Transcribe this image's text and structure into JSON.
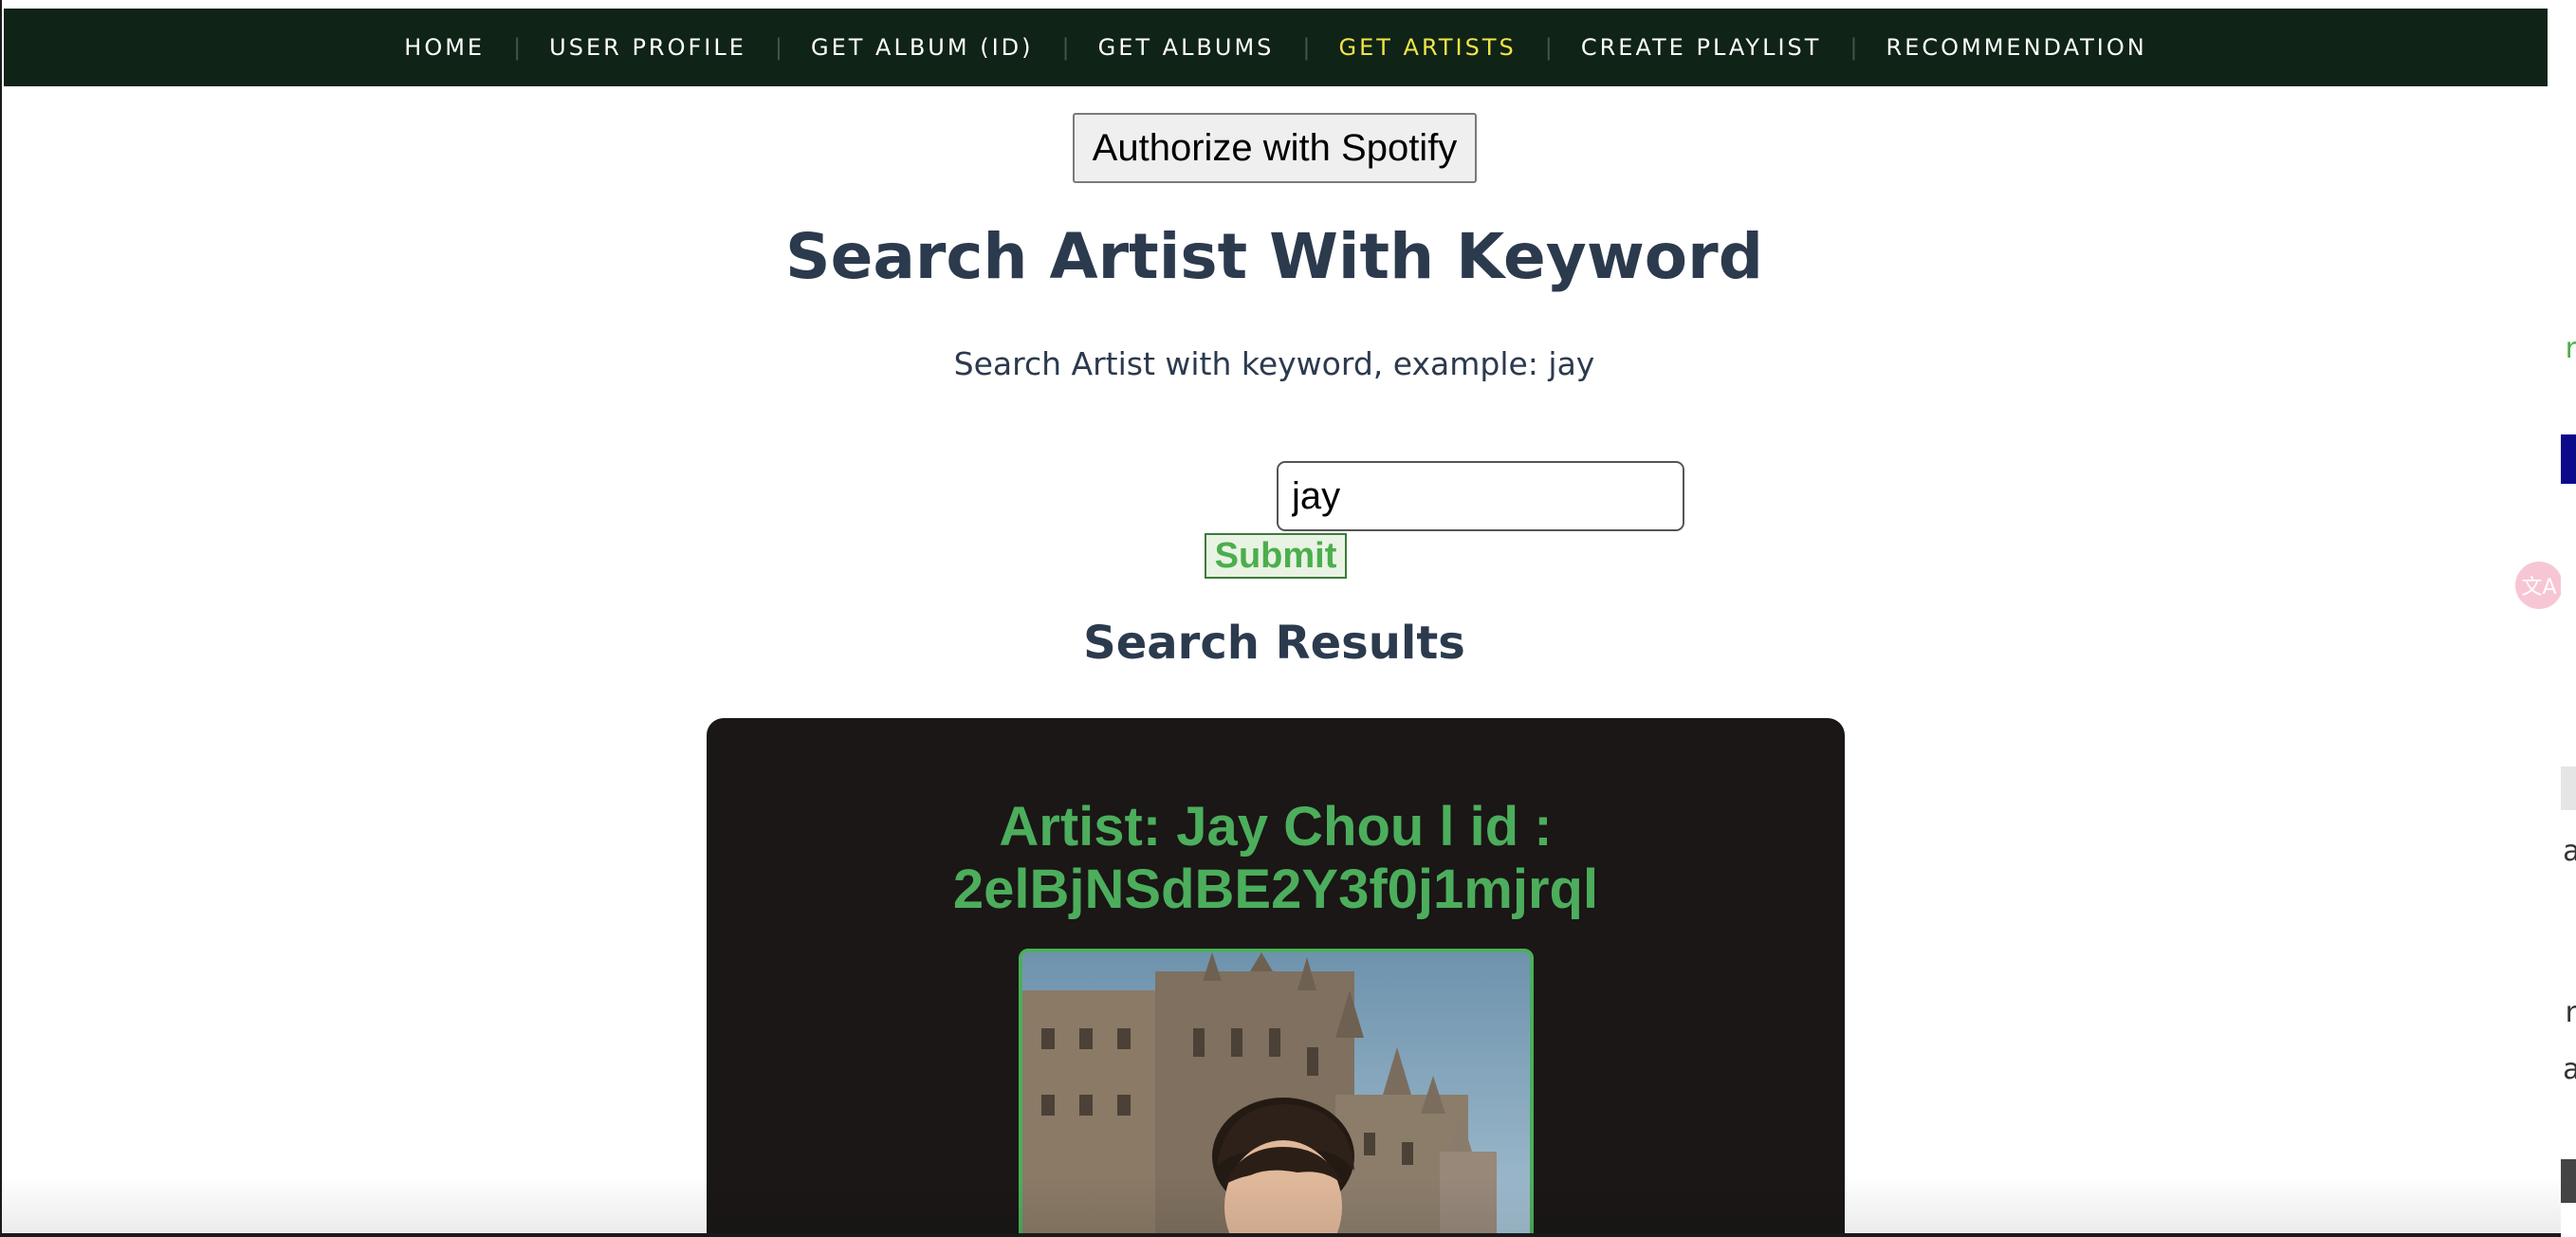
{
  "nav": {
    "items": [
      {
        "label": "HOME"
      },
      {
        "label": "USER PROFILE"
      },
      {
        "label": "GET ALBUM (ID)"
      },
      {
        "label": "GET ALBUMS"
      },
      {
        "label": "GET ARTISTS"
      },
      {
        "label": "CREATE PLAYLIST"
      },
      {
        "label": "RECOMMENDATION"
      }
    ],
    "active": "GET ARTISTS",
    "background_color": "#0f2316",
    "active_color": "#f2e34a"
  },
  "auth": {
    "button_label": "Authorize with Spotify"
  },
  "search": {
    "title": "Search Artist With Keyword",
    "hint": "Search Artist with keyword, example: jay",
    "input_value": "jay",
    "submit_label": "Submit",
    "accent_color": "#4cae5c"
  },
  "results": {
    "title": "Search Results",
    "items": [
      {
        "heading": "Artist: Jay Chou l id : 2elBjNSdBE2Y3f0j1mjrql",
        "image_icon": "artist-photo"
      }
    ]
  },
  "extension": {
    "icon": "translate-icon"
  }
}
